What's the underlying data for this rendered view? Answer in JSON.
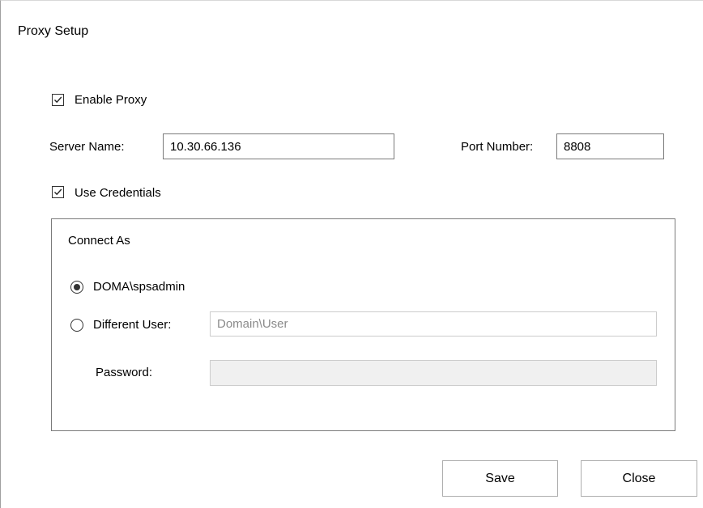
{
  "dialog": {
    "title": "Proxy Setup"
  },
  "enable_proxy": {
    "label": "Enable Proxy",
    "checked": true
  },
  "server": {
    "label": "Server Name:",
    "value": "10.30.66.136"
  },
  "port": {
    "label": "Port Number:",
    "value": "8808"
  },
  "use_credentials": {
    "label": "Use Credentials",
    "checked": true
  },
  "connect_as": {
    "group_label": "Connect As",
    "current_user": {
      "label": "DOMA\\spsadmin",
      "selected": true
    },
    "different_user": {
      "label": "Different User:",
      "placeholder": "Domain\\User",
      "selected": false
    },
    "password": {
      "label": "Password:",
      "value": ""
    }
  },
  "buttons": {
    "save": "Save",
    "close": "Close"
  },
  "icons": {
    "checkbox_check": "check-icon"
  }
}
